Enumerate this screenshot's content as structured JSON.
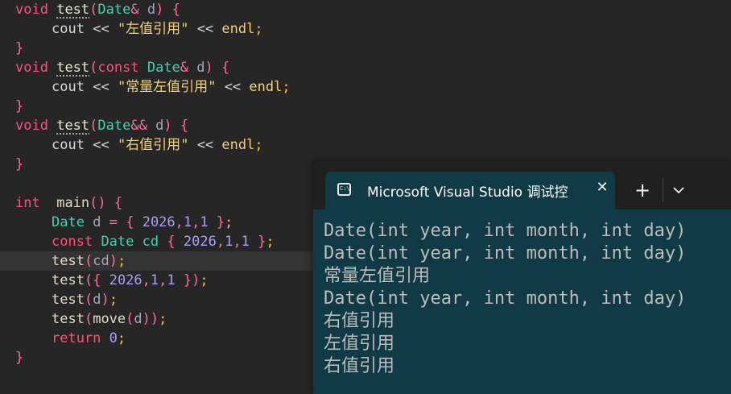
{
  "editor": {
    "lines": [
      [
        "void",
        " ",
        "test",
        "(",
        "Date",
        "&",
        " ",
        "d",
        ")",
        " ",
        "{"
      ],
      [
        "cout",
        " ",
        "<<",
        " ",
        "\"",
        "左值引用",
        "\"",
        " ",
        "<<",
        " ",
        "endl",
        ";"
      ],
      [
        "}"
      ],
      [
        "void",
        " ",
        "test",
        "(",
        "const",
        " ",
        "Date",
        "&",
        " ",
        "d",
        ")",
        " ",
        "{"
      ],
      [
        "cout",
        " ",
        "<<",
        " ",
        "\"",
        "常量左值引用",
        "\"",
        " ",
        "<<",
        " ",
        "endl",
        ";"
      ],
      [
        "}"
      ],
      [
        "void",
        " ",
        "test",
        "(",
        "Date",
        "&&",
        " ",
        "d",
        ")",
        " ",
        "{"
      ],
      [
        "cout",
        " ",
        "<<",
        " ",
        "\"",
        "右值引用",
        "\"",
        " ",
        "<<",
        " ",
        "endl",
        ";"
      ],
      [
        "}"
      ],
      [],
      [
        "int",
        "  ",
        "main",
        "()",
        " ",
        "{"
      ],
      [
        "Date",
        " ",
        "d",
        " ",
        "=",
        " ",
        "{",
        " ",
        "2026",
        ",",
        "1",
        ",",
        "1",
        " ",
        "}",
        ";"
      ],
      [
        "const",
        " ",
        "Date",
        " ",
        "cd",
        " ",
        "{",
        " ",
        "2026",
        ",",
        "1",
        ",",
        "1",
        " ",
        "}",
        ";"
      ],
      [
        "test",
        "(",
        "cd",
        ")",
        ";"
      ],
      [
        "test",
        "(",
        "{",
        " ",
        "2026",
        ",",
        "1",
        ",",
        "1",
        " ",
        "}",
        ")",
        ";"
      ],
      [
        "test",
        "(",
        "d",
        ")",
        ";"
      ],
      [
        "test",
        "(",
        "move",
        "(",
        "d",
        ")",
        ")",
        ";"
      ],
      [
        "return",
        " ",
        "0",
        ";"
      ],
      [
        "}"
      ]
    ]
  },
  "terminal": {
    "tab_title": "Microsoft Visual Studio 调试控",
    "tab_icon": "console-icon",
    "close_glyph": "✕",
    "new_tab_glyph": "+",
    "output": [
      "Date(int year, int month, int day)",
      "Date(int year, int month, int day)",
      "常量左值引用",
      "Date(int year, int month, int day)",
      "右值引用",
      "左值引用",
      "右值引用"
    ]
  }
}
